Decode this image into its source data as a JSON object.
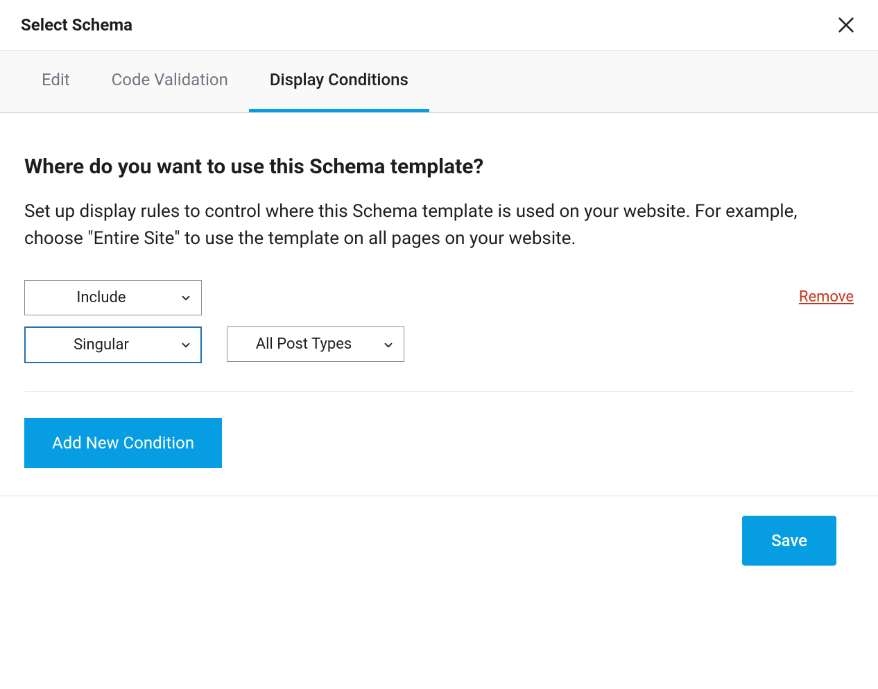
{
  "dialog": {
    "title": "Select Schema"
  },
  "tabs": {
    "edit": "Edit",
    "code_validation": "Code Validation",
    "display_conditions": "Display Conditions"
  },
  "content": {
    "heading": "Where do you want to use this Schema template?",
    "description": "Set up display rules to control where this Schema template is used on your website. For example, choose \"Entire Site\" to use the template on all pages on your website."
  },
  "condition": {
    "mode": "Include",
    "scope": "Singular",
    "post_type": "All Post Types",
    "remove_label": "Remove"
  },
  "buttons": {
    "add_condition": "Add New Condition",
    "save": "Save"
  }
}
